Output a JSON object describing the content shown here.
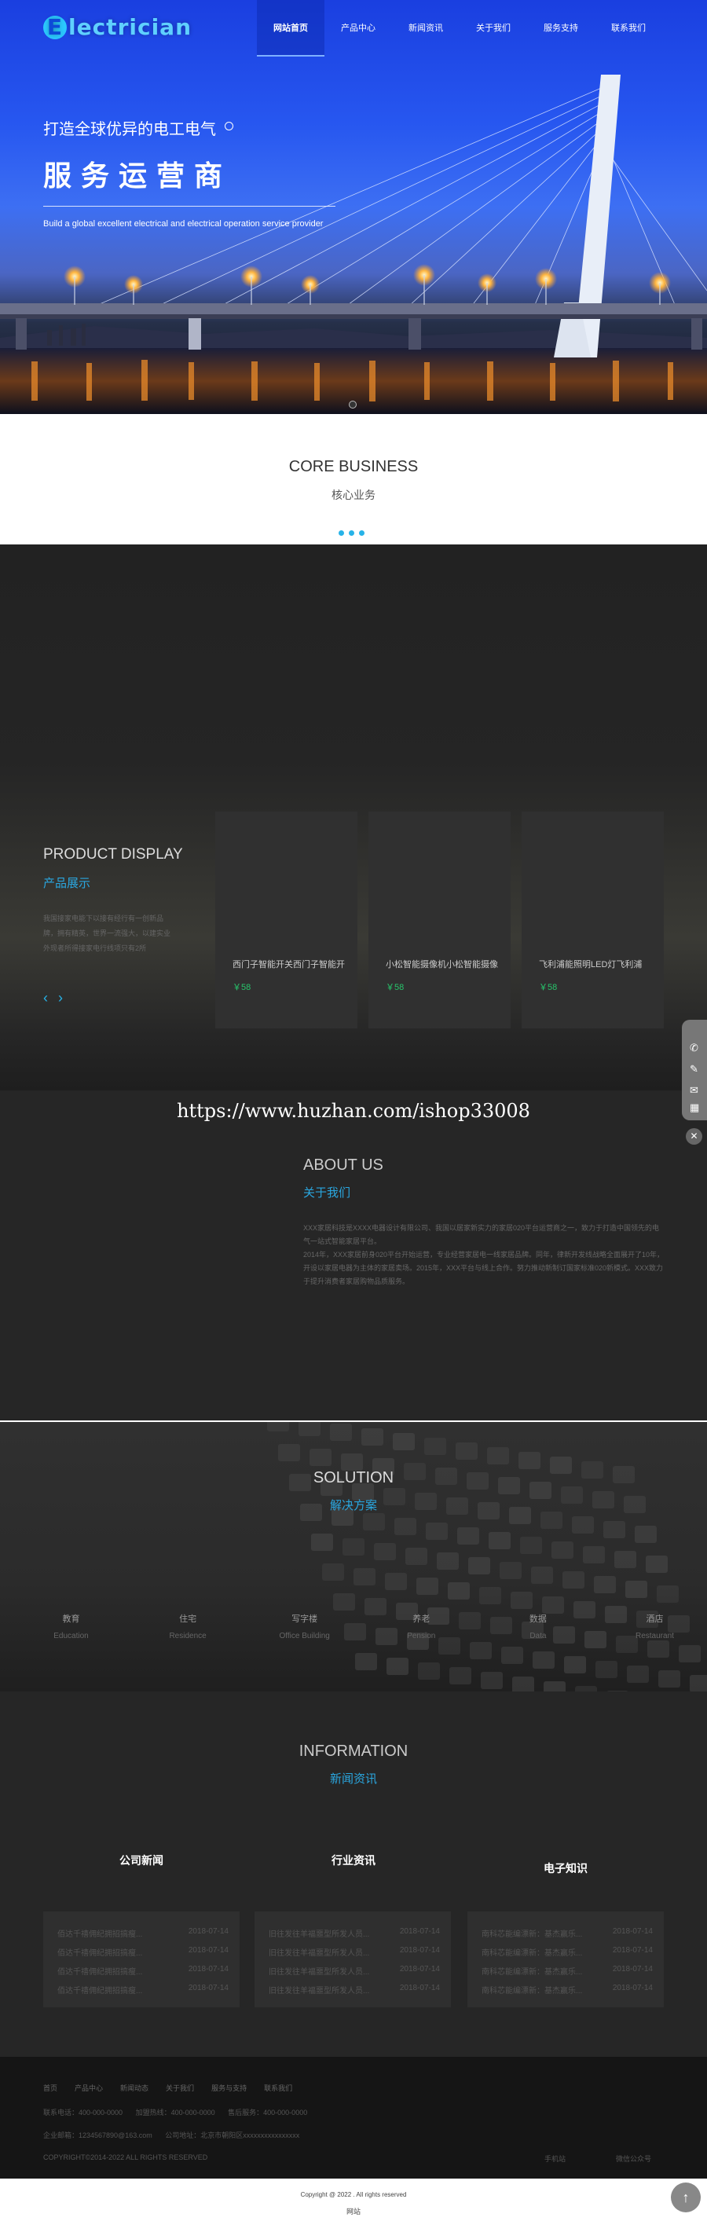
{
  "header": {
    "logo_letter": "E",
    "logo_rest": "lectrician",
    "nav": [
      "网站首页",
      "产品中心",
      "新闻资讯",
      "关于我们",
      "服务支持",
      "联系我们"
    ]
  },
  "hero": {
    "subtitle": "打造全球优异的电工电气",
    "title": "服务运营商",
    "english": "Build a global excellent electrical and electrical operation service provider"
  },
  "core": {
    "en": "CORE BUSINESS",
    "cn": "核心业务"
  },
  "product": {
    "en": "PRODUCT DISPLAY",
    "cn": "产品展示",
    "desc": "我国接家电能下以接有经行有一创新品牌，拥有精英，世界一流强大，以建实业外现者所得接家电行线项只有2所",
    "prev": "‹",
    "next": "›",
    "cards": [
      {
        "title": "西门子智能开关西门子智能开",
        "price": "￥58"
      },
      {
        "title": "小松智能摄像机小松智能摄像",
        "price": "￥58"
      },
      {
        "title": "飞利浦能照明LED灯飞利浦",
        "price": "￥58"
      }
    ]
  },
  "watermark": "https://www.huzhan.com/ishop33008",
  "sidebar": {
    "phone": "✆",
    "edit": "✎",
    "mail": "✉",
    "qr": "▦",
    "close": "✕"
  },
  "about": {
    "en": "ABOUT US",
    "cn": "关于我们",
    "p1": "XXX家居科技是XXXX电器设计有限公司、我国以居家新实力的家居020平台运营商之一，致力于打造中国领先的电气一站式智能家居平台。",
    "p2": "2014年，XXX家居前身020平台开始运营，专业经营家居电一线家居品牌。同年，律新开发线战略全面展开了10年，开设以家居电器为主体的家居卖场。2015年，XXX平台与线上合作。努力推动新制订国家标准020新模式。XXX致力于提升消费者家居购物品质服务。"
  },
  "solution": {
    "en": "SOLUTION",
    "cn": "解决方案",
    "items": [
      {
        "cn": "教育",
        "en": "Education"
      },
      {
        "cn": "住宅",
        "en": "Residence"
      },
      {
        "cn": "写字楼",
        "en": "Office Building"
      },
      {
        "cn": "养老",
        "en": "Pension"
      },
      {
        "cn": "数据",
        "en": "Data"
      },
      {
        "cn": "酒店",
        "en": "Restaurant"
      }
    ]
  },
  "information": {
    "en": "INFORMATION",
    "cn": "新闻资讯",
    "cats": [
      "公司新闻",
      "行业资讯",
      "电子知识"
    ],
    "lists": [
      [
        {
          "t": "佰达千禧佣纪拥招搞瘦...",
          "d": "2018-07-14"
        },
        {
          "t": "佰达千禧佣纪拥招搞瘦...",
          "d": "2018-07-14"
        },
        {
          "t": "佰达千禧佣纪拥招搞瘦...",
          "d": "2018-07-14"
        },
        {
          "t": "佰达千禧佣纪拥招搞瘦...",
          "d": "2018-07-14"
        }
      ],
      [
        {
          "t": "旧往发往羊福噩型所发人员...",
          "d": "2018-07-14"
        },
        {
          "t": "旧往发往羊福噩型所发人员...",
          "d": "2018-07-14"
        },
        {
          "t": "旧往发往羊福噩型所发人员...",
          "d": "2018-07-14"
        },
        {
          "t": "旧往发往羊福噩型所发人员...",
          "d": "2018-07-14"
        }
      ],
      [
        {
          "t": "南科芯能编漂新：基杰赢乐...",
          "d": "2018-07-14"
        },
        {
          "t": "南科芯能编漂新：基杰赢乐...",
          "d": "2018-07-14"
        },
        {
          "t": "南科芯能编漂新：基杰赢乐...",
          "d": "2018-07-14"
        },
        {
          "t": "南科芯能编漂新：基杰赢乐...",
          "d": "2018-07-14"
        }
      ]
    ]
  },
  "footer": {
    "nav": [
      "首页",
      "产品中心",
      "新闻动态",
      "关于我们",
      "服务与支持",
      "联系我们"
    ],
    "phones": [
      "联系电话：400-000-0000",
      "加盟热线：400-000-0000",
      "售后服务：400-000-0000"
    ],
    "email": "企业邮箱：1234567890@163.com",
    "address": "公司地址：北京市朝阳区xxxxxxxxxxxxxxxx",
    "rights": "COPYRIGHT©2014-2022 ALL RIGHTS RESERVED",
    "wechat": "手机站",
    "official": "微信公众号",
    "copyright": "Copyright @ 2022 . All rights reserved",
    "site": "网站",
    "top": "↑"
  }
}
